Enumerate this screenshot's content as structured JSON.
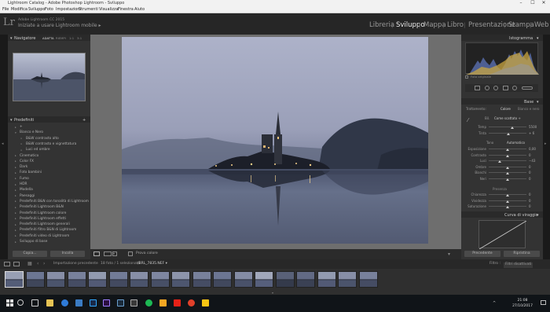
{
  "window": {
    "title": "Lightroom Catalog - Adobe Photoshop Lightroom - Sviluppo",
    "controls": [
      "–",
      "☐",
      "✕"
    ]
  },
  "menu": [
    "File",
    "Modifica",
    "Sviluppo",
    "Foto",
    "Impostazioni",
    "Strumenti",
    "Visualizza",
    "Finestra",
    "Aiuto"
  ],
  "identity": {
    "logo": "Lr",
    "product": "Adobe Lightroom CC 2015",
    "mobile_prompt": "Iniziate a usare Lightroom mobile ▸"
  },
  "modules": {
    "items": [
      "Libreria",
      "Sviluppo",
      "Mappa",
      "Libro",
      "Presentazione",
      "Stampa",
      "Web"
    ],
    "active": "Sviluppo",
    "separator": "|"
  },
  "left_panel": {
    "navigator": {
      "label": "Navigatore",
      "modes": [
        "ADATTA",
        "RIEMPI",
        "1:1",
        "3:1"
      ]
    },
    "presets": {
      "label": "Predefiniti",
      "items": [
        {
          "label": "+",
          "level": 0
        },
        {
          "label": "Bianco e Nero",
          "level": 0,
          "open": true
        },
        {
          "label": "B&W contrasto alto",
          "level": 1
        },
        {
          "label": "B&W contrasto e vignettatura",
          "level": 1
        },
        {
          "label": "Luci ed ombre",
          "level": 1
        },
        {
          "label": "Cinematico",
          "level": 0
        },
        {
          "label": "Color FX",
          "level": 0
        },
        {
          "label": "Dark",
          "level": 0
        },
        {
          "label": "Foto bambini",
          "level": 0
        },
        {
          "label": "Fumo",
          "level": 0
        },
        {
          "label": "HDR",
          "level": 0
        },
        {
          "label": "Modella",
          "level": 0
        },
        {
          "label": "Paesaggi",
          "level": 0
        },
        {
          "label": "Predefiniti B&N con tonalità di Lightroom",
          "level": 0
        },
        {
          "label": "Predefiniti Lightroom B&N",
          "level": 0
        },
        {
          "label": "Predefiniti Lightroom colore",
          "level": 0
        },
        {
          "label": "Predefiniti Lightroom effetti",
          "level": 0
        },
        {
          "label": "Predefiniti Lightroom generali",
          "level": 0
        },
        {
          "label": "Predefiniti filtro B&N di Lightroom",
          "level": 0
        },
        {
          "label": "Predefiniti video di Lightroom",
          "level": 0
        },
        {
          "label": "Sviluppo di base",
          "level": 0
        }
      ]
    },
    "copy_button": "Copia...",
    "paste_button": "Incolla"
  },
  "toolbar": {
    "proof_label": "Prova colore",
    "view_icons": [
      "loupe-view",
      "before-after-view",
      "compare-view"
    ]
  },
  "right_panel": {
    "histogram_label": "Istogramma",
    "original_photo": "Foto originale",
    "basic_label": "Base",
    "treatment": {
      "label": "Trattamento:",
      "options": [
        "Colore",
        "Bianco e nero"
      ],
      "active": "Colore"
    },
    "wb": {
      "label": "Bil.",
      "value": "Come scattato ÷"
    },
    "temp_tint": [
      {
        "label": "Temp",
        "value": "5500",
        "pos": 0.62
      },
      {
        "label": "Tinta",
        "value": "+ 6",
        "pos": 0.52
      }
    ],
    "tone_header": {
      "label": "Tono",
      "auto": "Automatico"
    },
    "tone": [
      {
        "label": "Esposizione",
        "value": "0,00",
        "pos": 0.5
      },
      {
        "label": "Contrasto",
        "value": "0",
        "pos": 0.5
      },
      {
        "label": "Luci",
        "value": "−43",
        "pos": 0.3
      },
      {
        "label": "Ombre",
        "value": "0",
        "pos": 0.5
      },
      {
        "label": "Bianchi",
        "value": "0",
        "pos": 0.5
      },
      {
        "label": "Neri",
        "value": "0",
        "pos": 0.5
      }
    ],
    "presence_header": "Presenza",
    "presence": [
      {
        "label": "Chiarezza",
        "value": "0",
        "pos": 0.5
      },
      {
        "label": "Vividezza",
        "value": "0",
        "pos": 0.5
      },
      {
        "label": "Saturazione",
        "value": "0",
        "pos": 0.5
      }
    ],
    "curve_label": "Curva di viraggio",
    "prev_button": "Precedente",
    "reset_button": "Ripristina"
  },
  "filmbar": {
    "source": "Importazione precedente",
    "count": "18 foto / 1 selezionata",
    "filename": "/BRL_7835.NEF ▾",
    "filter_label": "Filtro :",
    "filter_value": "Filtri disattivati"
  },
  "filmstrip": {
    "count": 18,
    "selected": 0
  },
  "taskbar": {
    "time": "21:08",
    "date": "27/10/2017"
  },
  "colors": {
    "panel": "#333333",
    "accent": "#cccccc",
    "taskbar": "#101418"
  }
}
